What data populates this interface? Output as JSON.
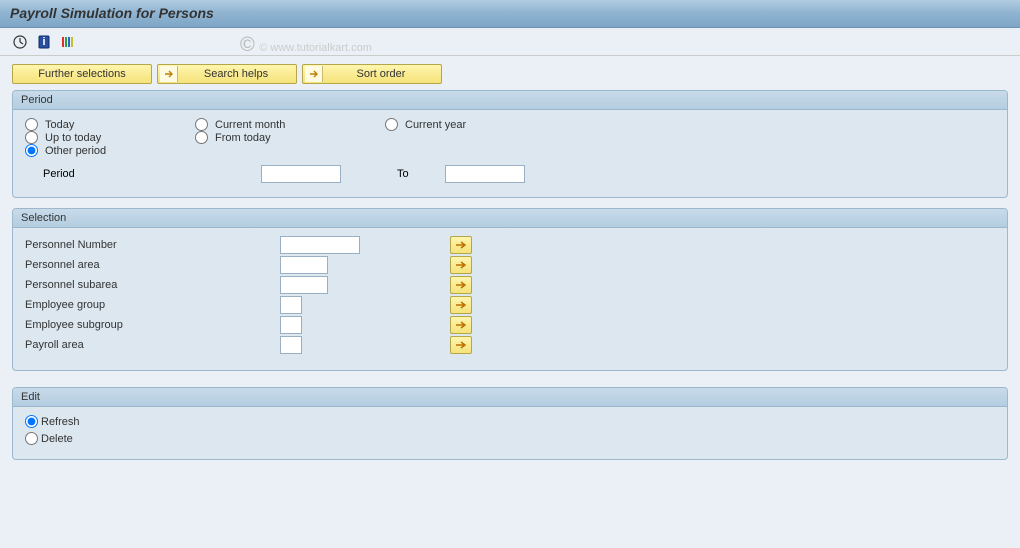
{
  "title": "Payroll Simulation for Persons",
  "watermark": "© www.tutorialkart.com",
  "buttons": {
    "further": "Further selections",
    "search": "Search helps",
    "sort": "Sort order"
  },
  "period": {
    "title": "Period",
    "today": "Today",
    "upto": "Up to today",
    "other": "Other period",
    "curmonth": "Current month",
    "fromtoday": "From today",
    "curyear": "Current year",
    "period_label": "Period",
    "to": "To",
    "selected": "other",
    "period_from": "",
    "period_to": ""
  },
  "selection": {
    "title": "Selection",
    "rows": [
      {
        "label": "Personnel Number",
        "value": "",
        "width": "w80"
      },
      {
        "label": "Personnel area",
        "value": "",
        "width": "w50"
      },
      {
        "label": "Personnel subarea",
        "value": "",
        "width": "w50"
      },
      {
        "label": "Employee group",
        "value": "",
        "width": "w30"
      },
      {
        "label": "Employee subgroup",
        "value": "",
        "width": "w30"
      },
      {
        "label": "Payroll area",
        "value": "",
        "width": "w30"
      }
    ]
  },
  "edit": {
    "title": "Edit",
    "refresh": "Refresh",
    "delete": "Delete",
    "selected": "refresh"
  }
}
